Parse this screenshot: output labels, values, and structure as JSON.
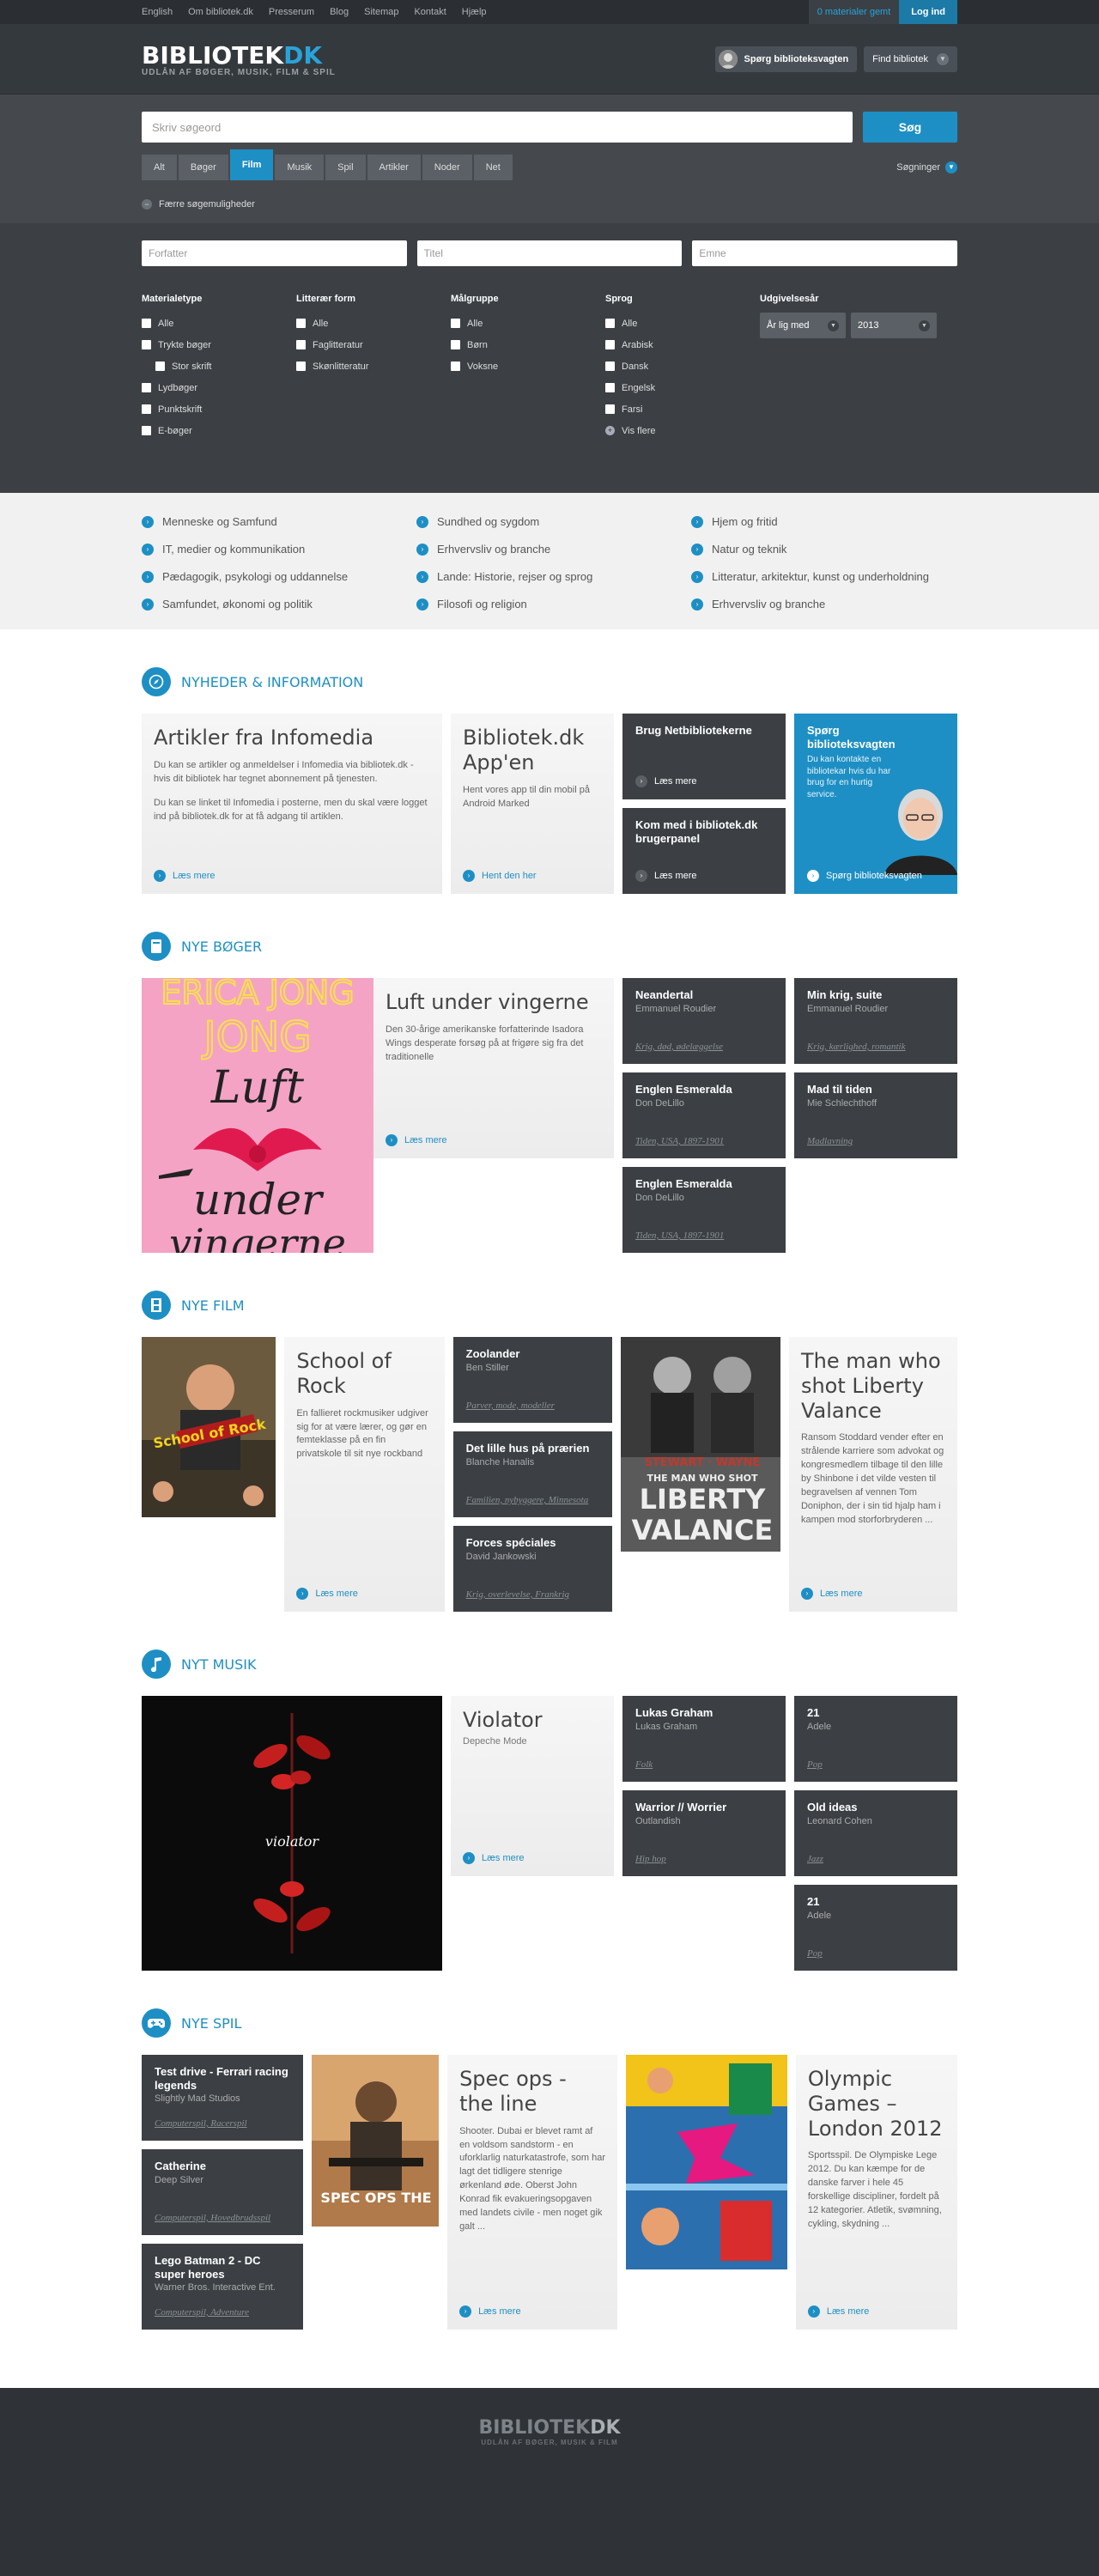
{
  "util": {
    "links": [
      "English",
      "Om bibliotek.dk",
      "Presserum",
      "Blog",
      "Sitemap",
      "Kontakt",
      "Hjælp"
    ],
    "saved": "0 materialer gemt",
    "login": "Log ind"
  },
  "header": {
    "logo_main": "BIBLIOTEK",
    "logo_accent": "DK",
    "tagline": "UDLÅN AF BØGER, MUSIK, FILM & SPIL",
    "ask_label": "Spørg biblioteksvagten",
    "find_label": "Find bibliotek"
  },
  "search": {
    "placeholder": "Skriv søgeord",
    "button": "Søg",
    "tabs": [
      "Alt",
      "Bøger",
      "Film",
      "Musik",
      "Spil",
      "Artikler",
      "Noder",
      "Net"
    ],
    "active_tab": "Film",
    "tips": "Søgninger",
    "fewer": "Færre søgemuligheder"
  },
  "filters": {
    "author": "Forfatter",
    "title": "Titel",
    "subject": "Emne",
    "materialetype": {
      "title": "Materialetype",
      "options": [
        "Alle",
        "Trykte bøger",
        "Stor skrift",
        "Lydbøger",
        "Punktskrift",
        "E-bøger"
      ]
    },
    "litform": {
      "title": "Litterær form",
      "options": [
        "Alle",
        "Faglitteratur",
        "Skønlitteratur"
      ]
    },
    "maalgruppe": {
      "title": "Målgruppe",
      "options": [
        "Alle",
        "Børn",
        "Voksne"
      ]
    },
    "sprog": {
      "title": "Sprog",
      "options": [
        "Alle",
        "Arabisk",
        "Dansk",
        "Engelsk",
        "Farsi"
      ],
      "more": "Vis flere"
    },
    "year": {
      "title": "Udgivelsesår",
      "mode": "År lig med",
      "value": "2013"
    }
  },
  "categories": [
    "Menneske og Samfund",
    "Sundhed og sygdom",
    "Hjem og fritid",
    "IT, medier og kommunikation",
    "Erhvervsliv og branche",
    "Natur og teknik",
    "Pædagogik, psykologi og uddannelse",
    "Lande: Historie, rejser og sprog",
    "Litteratur, arkitektur, kunst og underholdning",
    "Samfundet, økonomi og politik",
    "Filosofi og religion",
    "Erhvervsliv og branche"
  ],
  "news": {
    "title": "NYHEDER & INFORMATION",
    "infomedia": {
      "title": "Artikler fra Infomedia",
      "p1": "Du kan se artikler og anmeldelser i Infomedia via bibliotek.dk - hvis dit bibliotek har tegnet abonnement på tjenesten.",
      "p2": "Du kan se linket til Infomedia i posterne, men du skal være logget ind på bibliotek.dk for at få adgang til artiklen.",
      "more": "Læs mere"
    },
    "app": {
      "title": "Bibliotek.dk App'en",
      "p": "Hent vores app til din mobil på Android Marked",
      "more": "Hent den her"
    },
    "netbib": {
      "title": "Brug Netbibliotekerne",
      "more": "Læs mere"
    },
    "panel": {
      "title": "Kom med i bibliotek.dk brugerpanel",
      "more": "Læs mere"
    },
    "ask": {
      "title": "Spørg biblioteksvagten",
      "p": "Du kan kontakte en bibliotekar hvis du har brug for en hurtig service.",
      "more": "Spørg biblioteksvagten"
    }
  },
  "books": {
    "title": "NYE BØGER",
    "feature": {
      "title": "Luft under vingerne",
      "p": "Den 30-årige amerikanske forfatterinde Isadora Wings desperate forsøg på at frigøre sig fra det traditionelle",
      "more": "Læs mere",
      "cover_author": "ERICA JONG",
      "cover_t1": "Luft",
      "cover_t2": "under",
      "cover_t3": "vingerne"
    },
    "items": [
      {
        "title": "Neandertal",
        "author": "Emmanuel Roudier",
        "tags": "Krig, død, ødelæggelse"
      },
      {
        "title": "Min krig, suite",
        "author": "Emmanuel Roudier",
        "tags": "Krig, kærlighed, romantik"
      },
      {
        "title": "Englen Esmeralda",
        "author": "Don DeLillo",
        "tags": "Tiden, USA, 1897-1901"
      },
      {
        "title": "Mad til tiden",
        "author": "Mie Schlechthoff",
        "tags": "Madlavning"
      },
      {
        "title": "Englen Esmeralda",
        "author": "Don DeLillo",
        "tags": "Tiden, USA, 1897-1901"
      }
    ]
  },
  "films": {
    "title": "NYE FILM",
    "feature1": {
      "title": "School of Rock",
      "p": "En fallieret rockmusiker udgiver sig for at være lærer, og gør en femteklasse på en fin privatskole til sit nye rockband",
      "more": "Læs mere",
      "cover_text": "School of Rock"
    },
    "items": [
      {
        "title": "Zoolander",
        "author": "Ben Stiller",
        "tags": "Parver, mode, modeller"
      },
      {
        "title": "Det lille hus på prærien",
        "author": "Blanche Hanalis",
        "tags": "Familien, nybyggere, Minnesota"
      },
      {
        "title": "Forces spéciales",
        "author": "David Jankowski",
        "tags": "Krig, overlevelse, Frankrig"
      }
    ],
    "feature2": {
      "title": "The man who shot Liberty Valance",
      "p": "Ransom Stoddard vender efter en strålende karriere som advokat og kongresmedlem tilbage til den lille by Shinbone i det vilde vesten til begravelsen af vennen Tom Doniphon, der i sin tid hjalp ham i kampen mod storforbryderen ...",
      "more": "Læs mere",
      "cover_top": "STEWART · WAYNE",
      "cover_mid": "THE MAN WHO SHOT",
      "cover_big1": "LIBERTY",
      "cover_big2": "VALANCE"
    }
  },
  "music": {
    "title": "NYT MUSIK",
    "feature": {
      "title": "Violator",
      "sub": "Depeche Mode",
      "more": "Læs mere",
      "cover_text": "violator"
    },
    "items": [
      {
        "title": "Lukas Graham",
        "author": "Lukas Graham",
        "tags": "Folk"
      },
      {
        "title": "21",
        "author": "Adele",
        "tags": "Pop"
      },
      {
        "title": "Warrior // Worrier",
        "author": "Outlandish",
        "tags": "Hip hop"
      },
      {
        "title": "Old ideas",
        "author": "Leonard Cohen",
        "tags": "Jazz"
      },
      {
        "title": "21",
        "author": "Adele",
        "tags": "Pop"
      }
    ]
  },
  "games": {
    "title": "NYE SPIL",
    "items": [
      {
        "title": "Test drive - Ferrari racing legends",
        "author": "Slightly Mad Studios",
        "tags": "Computerspil, Racerspil"
      },
      {
        "title": "Catherine",
        "author": "Deep Silver",
        "tags": "Computerspil, Hovedbrudsspil"
      },
      {
        "title": "Lego Batman 2 - DC super heroes",
        "author": "Warner Bros. Interactive Ent.",
        "tags": "Computerspil, Adventure"
      }
    ],
    "feature1": {
      "title": "Spec ops - the line",
      "p": "Shooter. Dubai er blevet ramt af en voldsom sandstorm - en uforklarlig naturkatastrofe, som har lagt det tidligere stenrige ørkenland øde. Oberst John Konrad fik evakueringsopgaven med landets civile - men noget gik galt ...",
      "more": "Læs mere",
      "cover_text": "SPEC OPS THE"
    },
    "feature2": {
      "title": "Olympic Games – London 2012",
      "p": "Sportsspil. De Olympiske Lege 2012. Du kan kæmpe for de danske farver i hele 45 forskellige discipliner, fordelt på 12 kategorier. Atletik, svømning, cykling, skydning ...",
      "more": "Læs mere"
    }
  },
  "footer": {
    "logo_main": "BIBLIOTEK",
    "logo_accent": "DK",
    "tagline": "UDLÅN AF BØGER, MUSIK & FILM"
  }
}
